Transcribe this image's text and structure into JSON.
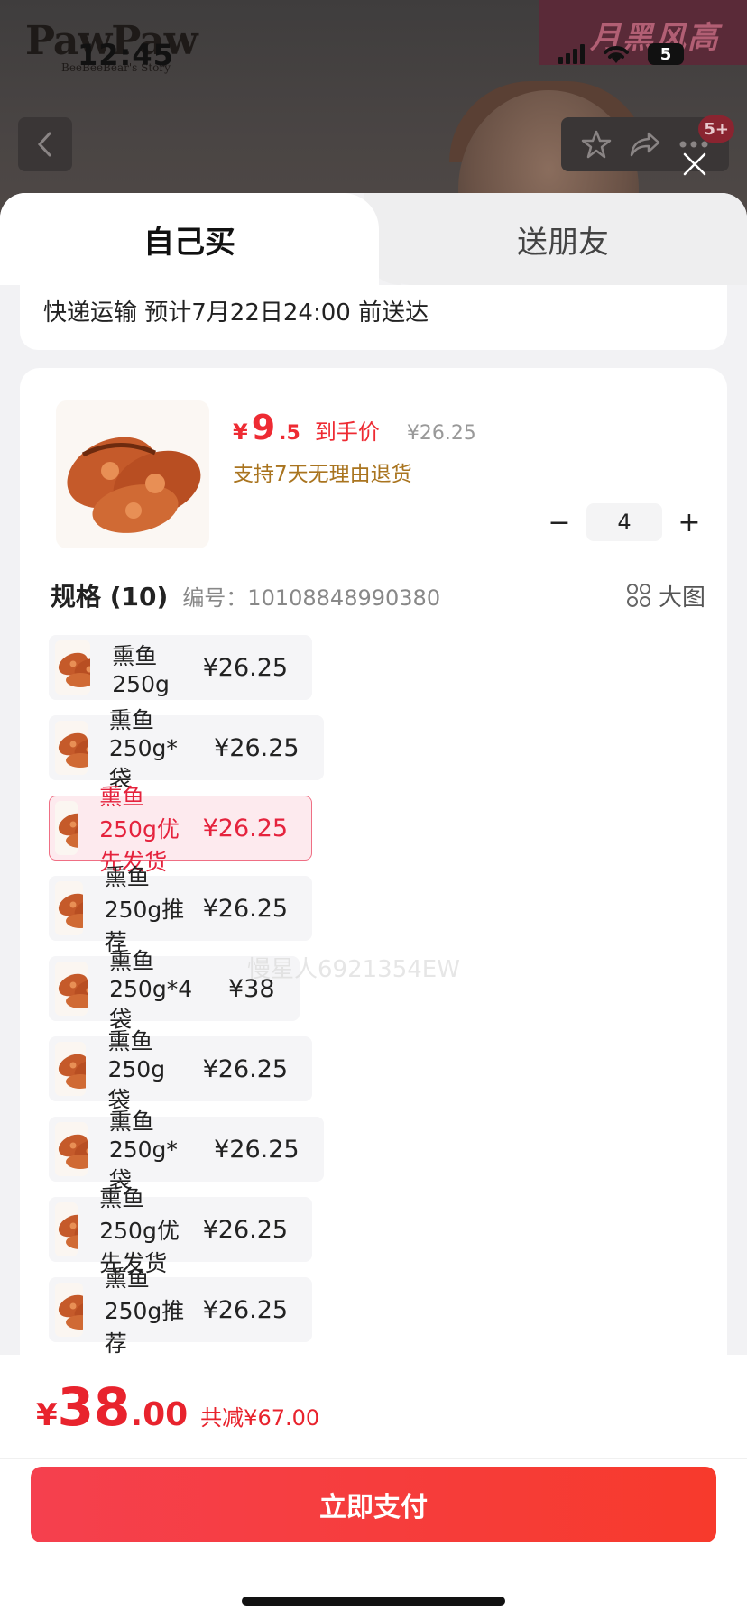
{
  "status_bar": {
    "time": "12:45",
    "battery": "5"
  },
  "brand": {
    "name": "PawPaw",
    "subtitle": "BeeBeeBear's Story"
  },
  "promo": {
    "text": "月黑风高"
  },
  "top_bar": {
    "badge": "5+"
  },
  "tabs": [
    {
      "label": "自己买",
      "active": true
    },
    {
      "label": "送朋友",
      "active": false
    }
  ],
  "shipping": {
    "text": "快递运输 预计7月22日24:00 前送达"
  },
  "product": {
    "price_symbol": "¥",
    "price_int": "9",
    "price_dec": ".5",
    "price_label": "到手价",
    "original_price": "¥26.25",
    "return_policy": "支持7天无理由退货",
    "quantity": "4",
    "qty_minus": "−",
    "qty_plus": "+"
  },
  "spec": {
    "title": "规格 (10)",
    "code": "编号：10108848990380",
    "big_picture": "大图",
    "items": [
      {
        "name": "熏鱼 250g",
        "price": "¥26.25"
      },
      {
        "name": "熏鱼 250g*袋",
        "price": "¥26.25"
      },
      {
        "name": "熏鱼 250g优先发货",
        "price": "¥26.25",
        "selected": true
      },
      {
        "name": "熏鱼 250g推荐",
        "price": "¥26.25"
      },
      {
        "name": "熏鱼 250g*4 袋",
        "price": "¥38"
      },
      {
        "name": "熏鱼 250g袋",
        "price": "¥26.25"
      },
      {
        "name": "熏鱼  250g*袋",
        "price": "¥26.25"
      },
      {
        "name": "熏鱼  250g优先发货",
        "price": "¥26.25"
      },
      {
        "name": "熏鱼  250g推荐",
        "price": "¥26.25"
      }
    ]
  },
  "watermark": "慢星人6921354EW",
  "footer": {
    "total_symbol": "¥",
    "total_int": "38",
    "total_dec": ".00",
    "saving": "共减¥67.00",
    "pay_label": "立即支付"
  },
  "colors": {
    "accent": "#ee2b33",
    "gold": "#a9741f",
    "selected_bg": "#fdeaee"
  }
}
